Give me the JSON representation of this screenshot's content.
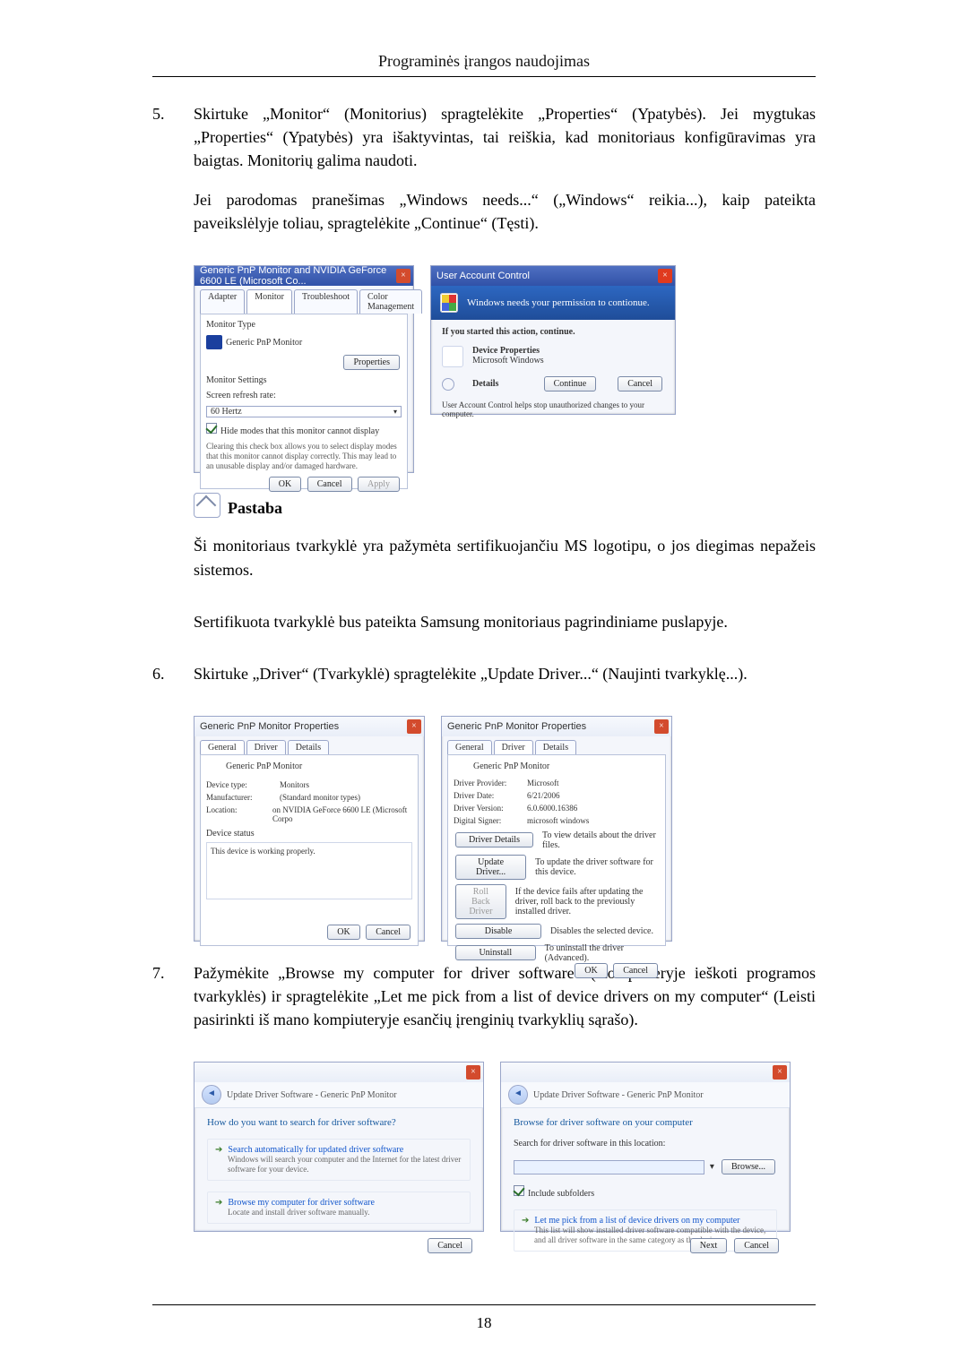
{
  "header": "Programinės įrangos naudojimas",
  "pageNum": "18",
  "step5": {
    "num": "5.",
    "p1": "Skirtuke „Monitor“ (Monitorius) spragtelėkite „Properties“ (Ypatybės). Jei mygtukas „Properties“ (Ypatybės) yra išaktyvintas, tai reiškia, kad monitoriaus konfigūravimas yra baigtas. Monitorių galima naudoti.",
    "p2": "Jei parodomas pranešimas „Windows needs...“ („Windows“ reikia...), kaip pateikta paveikslėlyje toliau, spragtelėkite „Continue“ (Tęsti)."
  },
  "fig1": {
    "title": "Generic PnP Monitor and NVIDIA GeForce 6600 LE (Microsoft Co...",
    "tabs": [
      "Adapter",
      "Monitor",
      "Troubleshoot",
      "Color Management"
    ],
    "monType": "Monitor Type",
    "monName": "Generic PnP Monitor",
    "props": "Properties",
    "settings": "Monitor Settings",
    "refresh": "Screen refresh rate:",
    "hz": "60 Hertz",
    "hide": "Hide modes that this monitor cannot display",
    "hint": "Clearing this check box allows you to select display modes that this monitor cannot display correctly. This may lead to an unusable display and/or damaged hardware.",
    "ok": "OK",
    "cancel": "Cancel",
    "apply": "Apply"
  },
  "fig2": {
    "title": "User Account Control",
    "headline": "Windows needs your permission to contionue.",
    "started": "If you started this action, continue.",
    "app": "Device Properties",
    "pub": "Microsoft Windows",
    "details": "Details",
    "cont": "Continue",
    "cancel": "Cancel",
    "footer": "User Account Control helps stop unauthorized changes to your computer."
  },
  "noteLabel": "Pastaba",
  "noteP1": "Ši monitoriaus tvarkyklė yra pažymėta sertifikuojančiu MS logotipu, o jos diegimas nepažeis sistemos.",
  "noteP2": "Sertifikuota tvarkyklė bus pateikta Samsung monitoriaus pagrindiniame puslapyje.",
  "step6": {
    "num": "6.",
    "text": "Skirtuke „Driver“ (Tvarkyklė) spragtelėkite „Update Driver...“ (Naujinti tvarkyklę...)."
  },
  "fig3": {
    "title": "Generic PnP Monitor Properties",
    "tabs": [
      "General",
      "Driver",
      "Details"
    ],
    "name": "Generic PnP Monitor",
    "kv": [
      {
        "k": "Device type:",
        "v": "Monitors"
      },
      {
        "k": "Manufacturer:",
        "v": "(Standard monitor types)"
      },
      {
        "k": "Location:",
        "v": "on NVIDIA GeForce 6600 LE (Microsoft Corpo"
      }
    ],
    "statusLbl": "Device status",
    "status": "This device is working properly.",
    "ok": "OK",
    "cancel": "Cancel"
  },
  "fig4": {
    "title": "Generic PnP Monitor Properties",
    "tabs": [
      "General",
      "Driver",
      "Details"
    ],
    "name": "Generic PnP Monitor",
    "kv": [
      {
        "k": "Driver Provider:",
        "v": "Microsoft"
      },
      {
        "k": "Driver Date:",
        "v": "6/21/2006"
      },
      {
        "k": "Driver Version:",
        "v": "6.0.6000.16386"
      },
      {
        "k": "Digital Signer:",
        "v": "microsoft windows"
      }
    ],
    "btns": [
      {
        "l": "Driver Details",
        "d": "To view details about the driver files."
      },
      {
        "l": "Update Driver...",
        "d": "To update the driver software for this device."
      },
      {
        "l": "Roll Back Driver",
        "d": "If the device fails after updating the driver, roll back to the previously installed driver.",
        "dis": true
      },
      {
        "l": "Disable",
        "d": "Disables the selected device."
      },
      {
        "l": "Uninstall",
        "d": "To uninstall the driver (Advanced)."
      }
    ],
    "ok": "OK",
    "cancel": "Cancel"
  },
  "step7": {
    "num": "7.",
    "text": "Pažymėkite „Browse my computer for driver software“ (Kompiuteryje ieškoti programos tvarkyklės) ir spragtelėkite „Let me pick from a list of device drivers on my computer“ (Leisti pasirinkti iš mano kompiuteryje esančių įrenginių tvarkyklių sąrašo)."
  },
  "fig5": {
    "bc": "Update Driver Software - Generic PnP Monitor",
    "q": "How do you want to search for driver software?",
    "o1t": "Search automatically for updated driver software",
    "o1d": "Windows will search your computer and the Internet for the latest driver software for your device.",
    "o2t": "Browse my computer for driver software",
    "o2d": "Locate and install driver software manually.",
    "cancel": "Cancel"
  },
  "fig6": {
    "bc": "Update Driver Software - Generic PnP Monitor",
    "h": "Browse for driver software on your computer",
    "s": "Search for driver software in this location:",
    "browse": "Browse...",
    "inc": "Include subfolders",
    "pick": "Let me pick from a list of device drivers on my computer",
    "pickd": "This list will show installed driver software compatible with the device, and all driver software in the same category as the device.",
    "next": "Next",
    "cancel": "Cancel"
  }
}
